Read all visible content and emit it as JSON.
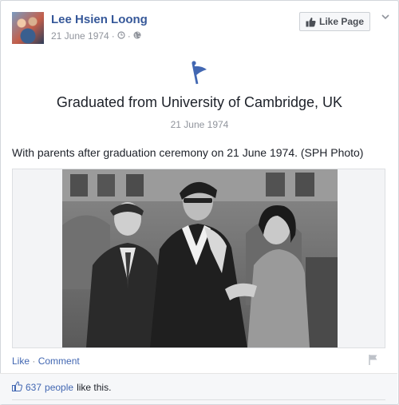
{
  "post": {
    "page_name": "Lee Hsien Loong",
    "date": "21 June 1974",
    "separator": "·",
    "meta_icons": [
      "clock-icon",
      "globe-icon"
    ],
    "like_page_label": "Like Page"
  },
  "milestone": {
    "icon": "flag-icon",
    "title": "Graduated from University of Cambridge, UK",
    "date": "21 June 1974"
  },
  "caption": "With parents after graduation ceremony on 21 June 1974. (SPH Photo)",
  "actions": {
    "like_label": "Like",
    "separator": "·",
    "comment_label": "Comment"
  },
  "likes": {
    "count": "637",
    "people_label": "people",
    "suffix": "like this."
  },
  "colors": {
    "link": "#365899",
    "accent": "#4267b2",
    "muted": "#90949c"
  }
}
